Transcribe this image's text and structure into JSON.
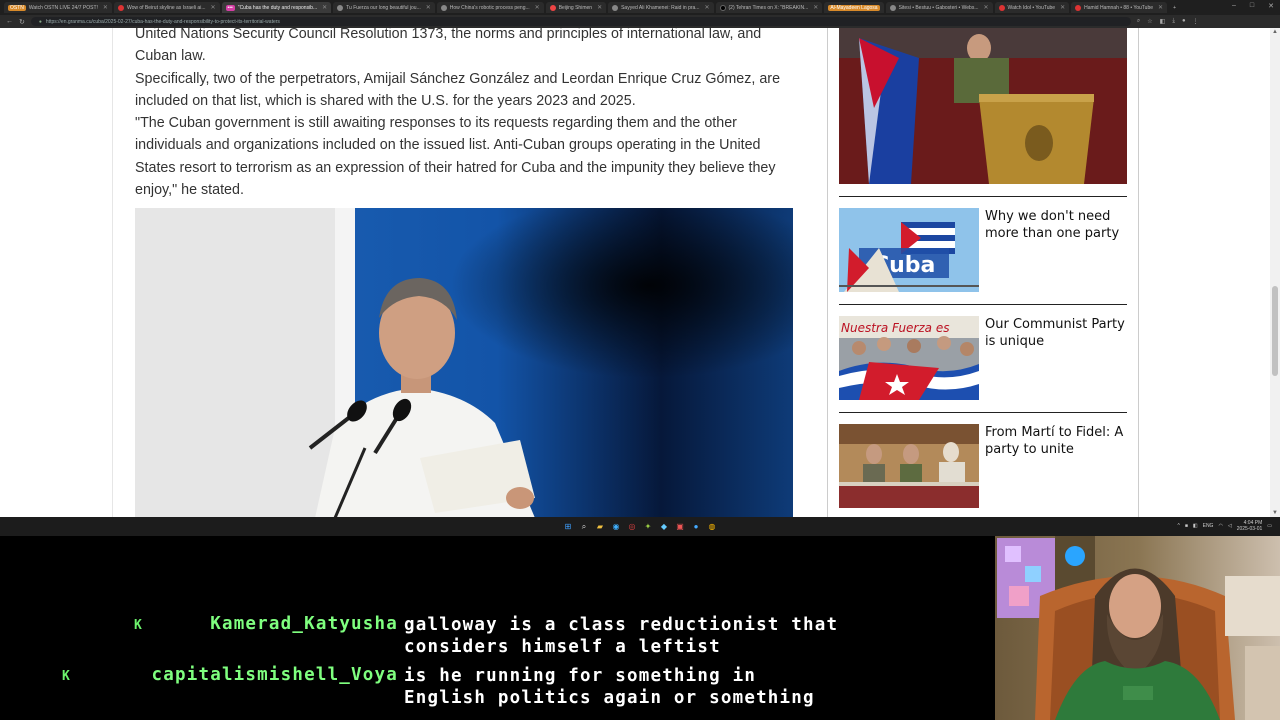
{
  "browser": {
    "tabs": [
      {
        "label": "Watch OSTN LIVE 24/7 POST! ",
        "pill": "ostn"
      },
      {
        "label": "Wow of Beirut skyline as Israeli ai..."
      },
      {
        "label": "\"Cuba has the duty and responsib...",
        "pill": "",
        "active": true
      },
      {
        "label": "Tu Fuerza our long beautiful jou..."
      },
      {
        "label": "How China's robotic process peng..."
      },
      {
        "label": "Beijing Shimen"
      },
      {
        "label": "Sayyed Ali Khamenei: Raid in pra..."
      },
      {
        "label": "(2) Tehran Times on X: \"BREAKIN..."
      },
      {
        "label": "Al-Mayadeen Lagosa",
        "pill": "orange"
      },
      {
        "label": "Sitesi • Bestuu • Gabosteri • Webs..."
      },
      {
        "label": "Watch Idol • YouTube"
      },
      {
        "label": "Hamid Hamnah • 88 • YouTube"
      }
    ],
    "url": "https://en.granma.cu/cuba/2025-02-27/cuba-has-the-duty-and-responsibility-to-protect-its-territorial-waters",
    "new_tab": "+",
    "window_controls": [
      "–",
      "□",
      "✕"
    ]
  },
  "article": {
    "para0": "United Nations Security Council Resolution 1373, the norms and principles of international law, and Cuban law.",
    "para1": "Specifically, two of the perpetrators, Amijail Sánchez González and Leordan Enrique Cruz Gómez, are included on that list, which is shared with the U.S. for the years 2023 and 2025.",
    "para2": "\"The Cuban government is still awaiting responses to its requests regarding them and the other individuals and organizations included on the issued list. Anti-Cuban groups operating in the United States resort to terrorism as an expression of their hatred for Cuba and the impunity they believe they enjoy,\" he stated."
  },
  "sidebar": {
    "items": [
      {
        "title": "Why we don't need more than one party",
        "thumb": "cuba-sign-thumbnail"
      },
      {
        "title": "Our Communist Party is unique",
        "thumb": "flag-crowd-thumbnail"
      },
      {
        "title": "From Martí to Fidel: A party to unite",
        "thumb": "leaders-table-thumbnail"
      }
    ]
  },
  "taskbar": {
    "clock_time": "4:04 PM",
    "clock_date": "2025-03-01",
    "lang": "ENG"
  },
  "chat": {
    "messages": [
      {
        "badge": "K",
        "user": "Kamerad_Katyusha",
        "lines": [
          "galloway is a class reductionist that",
          "considers himself a leftist"
        ]
      },
      {
        "badge": "K",
        "user": "capitalismishell_Voya",
        "lines": [
          "is he running for something in",
          "English politics again or something"
        ]
      }
    ]
  },
  "colors": {
    "chat_username": "#7fff7f",
    "chat_text": "#ffffff",
    "article_text": "#333333"
  }
}
